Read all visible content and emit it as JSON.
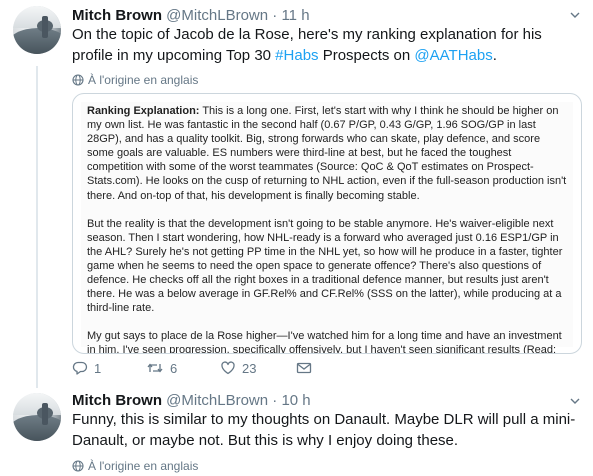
{
  "tweets": [
    {
      "author": {
        "name": "Mitch Brown",
        "handle": "@MitchLBrown"
      },
      "separator": "·",
      "time": "11 h",
      "text_parts": {
        "t1": "On the topic of Jacob de la Rose, here's my ranking explanation for his profile in my upcoming Top 30 ",
        "hashtag": "#Habs",
        "t2": " Prospects on ",
        "mention": "@AATHabs",
        "t3": "."
      },
      "translate_label": "À l'origine en anglais",
      "media": {
        "p1_heading": "Ranking Explanation:",
        "p1_body": " This is a long one. First, let's start with why I think he should be higher on my own list. He was fantastic in the second half (0.67 P/GP, 0.43 G/GP, 1.96 SOG/GP in last 28GP), and has a quality toolkit. Big, strong forwards who can skate, play defence, and score some goals are valuable. ES numbers were third-line at best, but he faced the toughest competition with some of the worst teammates (Source: QoC & QoT estimates on Prospect-Stats.com). He looks on the cusp of returning to NHL action, even if the full-season production isn't there. And on-top of that, his development is finally becoming stable.",
        "p2": "But the reality is that the development isn't going to be stable anymore. He's waiver-eligible next season. Then I start wondering, how NHL-ready is a forward who averaged just 0.16 ESP1/GP in the AHL? Surely he's not getting PP time in the NHL yet, so how will he produce in a faster, tighter game when he seems to need the open space to generate offence? There's also questions of defence. He checks off all the right boxes in a traditional defence manner, but results just aren't there. He was a below average in GF.Rel% and CF.Rel% (SSS on the latter), while producing at a third-line rate.",
        "p3": "My gut says to place de la Rose higher—I've watched him for a long time and have an investment in him. I've seen progression, specifically offensively, but I haven't seen significant results (Read: Points, GF%, etc.). So in what will likely be the last time de la Rose is eligible for my Top 30 Prospects, this ranking leans cautious rather than optimistic."
      },
      "actions": {
        "replies": "1",
        "retweets": "6",
        "likes": "23"
      }
    },
    {
      "author": {
        "name": "Mitch Brown",
        "handle": "@MitchLBrown"
      },
      "separator": "·",
      "time": "10 h",
      "text": "Funny, this is similar to my thoughts on Danault. Maybe DLR will pull a mini-Danault, or maybe not. But this is why I enjoy doing these.",
      "translate_label": "À l'origine en anglais"
    }
  ],
  "colors": {
    "link": "#1da1f2",
    "muted": "#657786",
    "text": "#14171a",
    "thread_line": "#e1e8ed"
  },
  "icons": [
    "caret-down-icon",
    "globe-icon",
    "reply-icon",
    "retweet-icon",
    "like-icon",
    "direct-message-icon"
  ]
}
